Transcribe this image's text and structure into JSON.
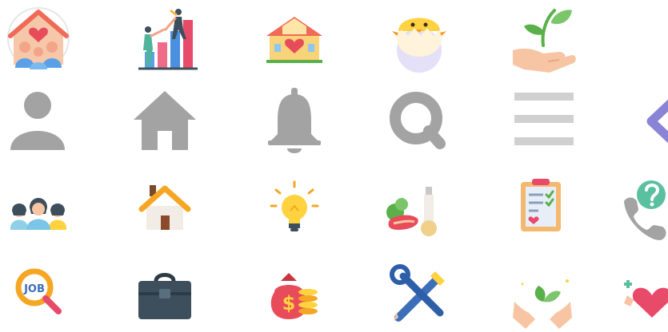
{
  "icons": {
    "row1": [
      "family-home-icon",
      "teamwork-growth-icon",
      "love-house-icon",
      "hatching-chick-icon",
      "plant-in-hand-icon"
    ],
    "row2": [
      "user-icon",
      "home-icon",
      "bell-icon",
      "search-icon",
      "menu-icon",
      "chevron-left-icon"
    ],
    "row3": [
      "group-icon",
      "house-icon",
      "lightbulb-icon",
      "groceries-icon",
      "clipboard-checklist-icon",
      "phone-help-icon"
    ],
    "row4": [
      "job-search-icon",
      "briefcase-icon",
      "money-bag-icon",
      "tools-icon",
      "plant-care-icon",
      "health-heart-icon"
    ]
  },
  "job_badge_text": "JOB",
  "money_symbol": "$",
  "help_symbol": "?",
  "colors": {
    "gray": "#a3a3a3",
    "light_gray": "#d0d0d0",
    "chevron": "#8a84d6",
    "orange": "#f5a623",
    "red": "#e84b5a",
    "blue": "#4a8fe0",
    "green": "#5bb04a",
    "yellow": "#ffd23f",
    "dark_slate": "#3d4f5c"
  }
}
